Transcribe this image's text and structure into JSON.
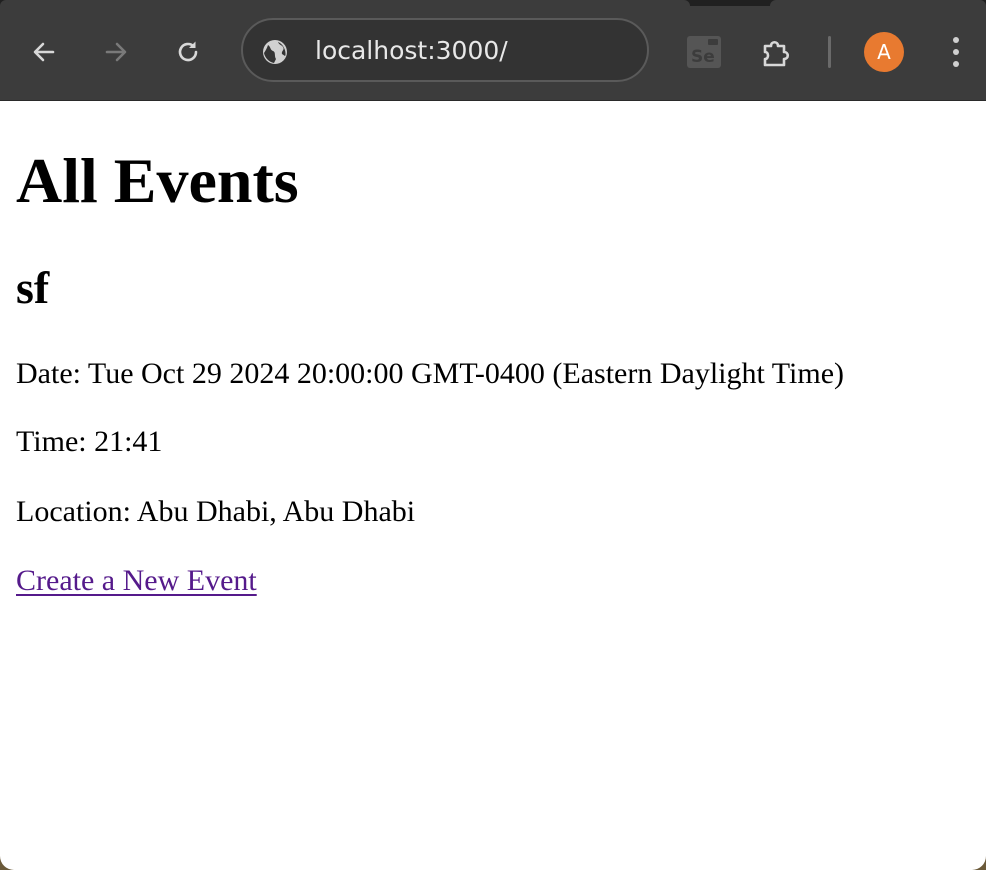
{
  "browser": {
    "url": "localhost:3000/",
    "profile_initial": "A",
    "extension_label": "Se",
    "colors": {
      "toolbar": "#3c3c3c",
      "avatar": "#e87a30",
      "link_visited": "#551a8b"
    },
    "icons": [
      "back-arrow-icon",
      "forward-arrow-icon",
      "reload-icon",
      "globe-icon",
      "selenium-extension-icon",
      "puzzle-extensions-icon",
      "more-menu-icon"
    ]
  },
  "page": {
    "heading": "All Events",
    "events": [
      {
        "title": "sf",
        "date_line": "Date: Tue Oct 29 2024 20:00:00 GMT-0400 (Eastern Daylight Time)",
        "time_line": "Time: 21:41",
        "location_line": "Location: Abu Dhabi, Abu Dhabi"
      }
    ],
    "create_link": "Create a New Event"
  }
}
